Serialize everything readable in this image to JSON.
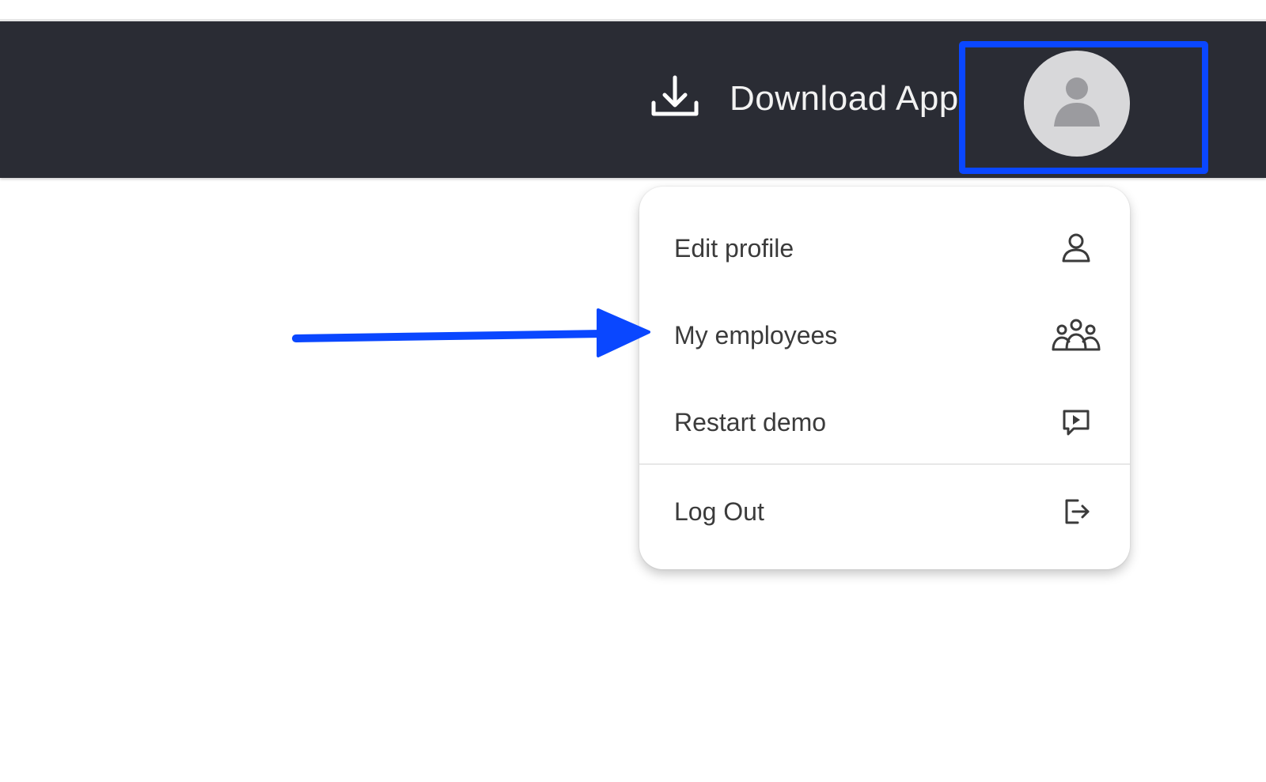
{
  "header": {
    "download_label": "Download App",
    "download_icon": "download-icon",
    "avatar_icon": "user-avatar-icon",
    "background": "#2a2c34",
    "highlight_color": "#0a47ff"
  },
  "menu": {
    "items": [
      {
        "label": "Edit profile",
        "icon": "person-icon"
      },
      {
        "label": "My employees",
        "icon": "people-group-icon"
      },
      {
        "label": "Restart demo",
        "icon": "play-message-icon"
      },
      {
        "label": "Log Out",
        "icon": "logout-icon"
      }
    ]
  },
  "annotation": {
    "arrow_color": "#0a47ff"
  }
}
